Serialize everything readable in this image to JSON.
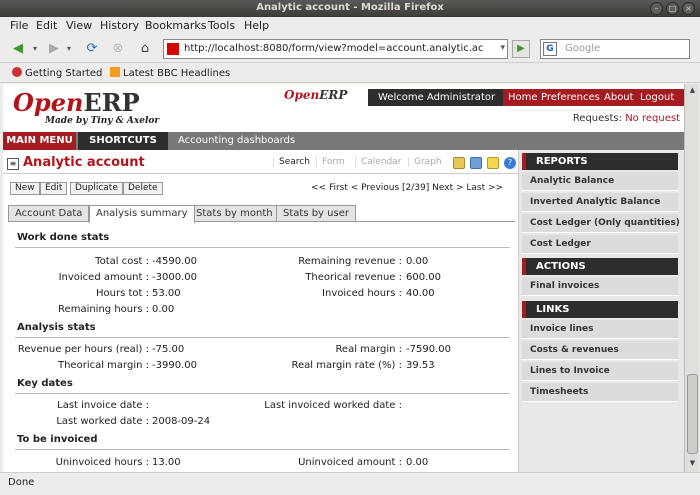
{
  "window": {
    "title": "Analytic account - Mozilla Firefox"
  },
  "menubar": {
    "items": [
      "File",
      "Edit",
      "View",
      "History",
      "Bookmarks",
      "Tools",
      "Help"
    ]
  },
  "navbar": {
    "url": "http://localhost:8080/form/view?model=account.analytic.accoun",
    "search_placeholder": "Google"
  },
  "bookmarks": {
    "items": [
      "Getting Started",
      "Latest BBC Headlines"
    ]
  },
  "header": {
    "logo_open": "Open",
    "logo_erp": "ERP",
    "logo_made": "Made by Tiny & Axelor",
    "small_logo_open": "Open",
    "small_logo_erp": "ERP",
    "welcome": "Welcome Administrator",
    "links": [
      "Home",
      "Preferences",
      "About",
      "Logout"
    ],
    "requests_label": "Requests:",
    "requests_value": "No request"
  },
  "mainbar": {
    "main_menu": "MAIN MENU",
    "shortcuts": "SHORTCUTS",
    "dashboard": "Accounting dashboards"
  },
  "page": {
    "title": "Analytic account",
    "header_buttons": [
      "Search",
      "Form",
      "Calendar",
      "Graph"
    ],
    "action_buttons": [
      "New",
      "Edit",
      "Duplicate",
      "Delete"
    ],
    "pager": "<< First < Previous [2/39] Next > Last >>",
    "tabs": [
      "Account Data",
      "Analysis summary",
      "Stats by month",
      "Stats by user"
    ],
    "active_tab": 1
  },
  "form": {
    "work_done": {
      "title": "Work done stats",
      "total_cost_label": "Total cost :",
      "total_cost": "-4590.00",
      "invoiced_amount_label": "Invoiced amount :",
      "invoiced_amount": "-3000.00",
      "hours_tot_label": "Hours tot :",
      "hours_tot": "53.00",
      "remaining_hours_label": "Remaining hours :",
      "remaining_hours": "0.00",
      "remaining_revenue_label": "Remaining revenue :",
      "remaining_revenue": "0.00",
      "theorical_revenue_label": "Theorical revenue :",
      "theorical_revenue": "600.00",
      "invoiced_hours_label": "Invoiced hours :",
      "invoiced_hours": "40.00"
    },
    "analysis": {
      "title": "Analysis stats",
      "revenue_per_hour_label": "Revenue per hours (real) :",
      "revenue_per_hour": "-75.00",
      "theorical_margin_label": "Theorical margin :",
      "theorical_margin": "-3990.00",
      "real_margin_label": "Real margin :",
      "real_margin": "-7590.00",
      "real_margin_rate_label": "Real margin rate (%) :",
      "real_margin_rate": "39.53"
    },
    "key_dates": {
      "title": "Key dates",
      "last_invoice_date_label": "Last invoice date :",
      "last_invoice_date": "",
      "last_worked_date_label": "Last worked date :",
      "last_worked_date": "2008-09-24",
      "last_invoiced_worked_date_label": "Last invoiced worked date :",
      "last_invoiced_worked_date": ""
    },
    "to_be_invoiced": {
      "title": "To be invoiced",
      "uninvoiced_hours_label": "Uninvoiced hours :",
      "uninvoiced_hours": "13.00",
      "uninvoiced_amount_label": "Uninvoiced amount :",
      "uninvoiced_amount": "0.00"
    }
  },
  "sidebar": {
    "reports_title": "REPORTS",
    "reports": [
      "Analytic Balance",
      "Inverted Analytic Balance",
      "Cost Ledger (Only quantities)",
      "Cost Ledger"
    ],
    "actions_title": "ACTIONS",
    "actions": [
      "Final invoices"
    ],
    "links_title": "LINKS",
    "links": [
      "Invoice lines",
      "Costs & revenues",
      "Lines to Invoice",
      "Timesheets"
    ]
  },
  "status": {
    "text": "Done"
  }
}
